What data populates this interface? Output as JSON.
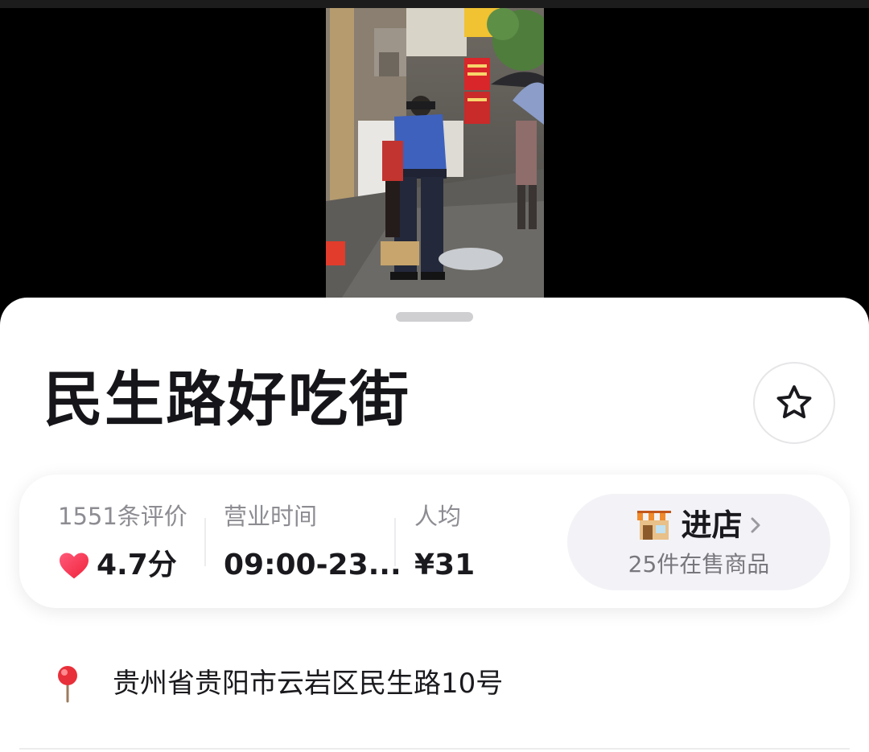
{
  "video": {
    "description_icon": "street-video-frame"
  },
  "shop": {
    "name": "民生路好吃街"
  },
  "stats": {
    "reviews_label": "1551条评价",
    "rating_value": "4.7分",
    "hours_label": "营业时间",
    "hours_value": "09:00-23...",
    "avg_label": "人均",
    "avg_value": "¥31"
  },
  "enter_shop": {
    "label": "进店",
    "subtitle": "25件在售商品",
    "icon": "store-icon"
  },
  "address": {
    "text": "贵州省贵阳市云岩区民生路10号",
    "icon": "location-pin-icon"
  },
  "colors": {
    "heart": "#f2364f",
    "text": "#16161a",
    "muted": "#8c8c92",
    "pill_bg": "#f3f3f7"
  }
}
